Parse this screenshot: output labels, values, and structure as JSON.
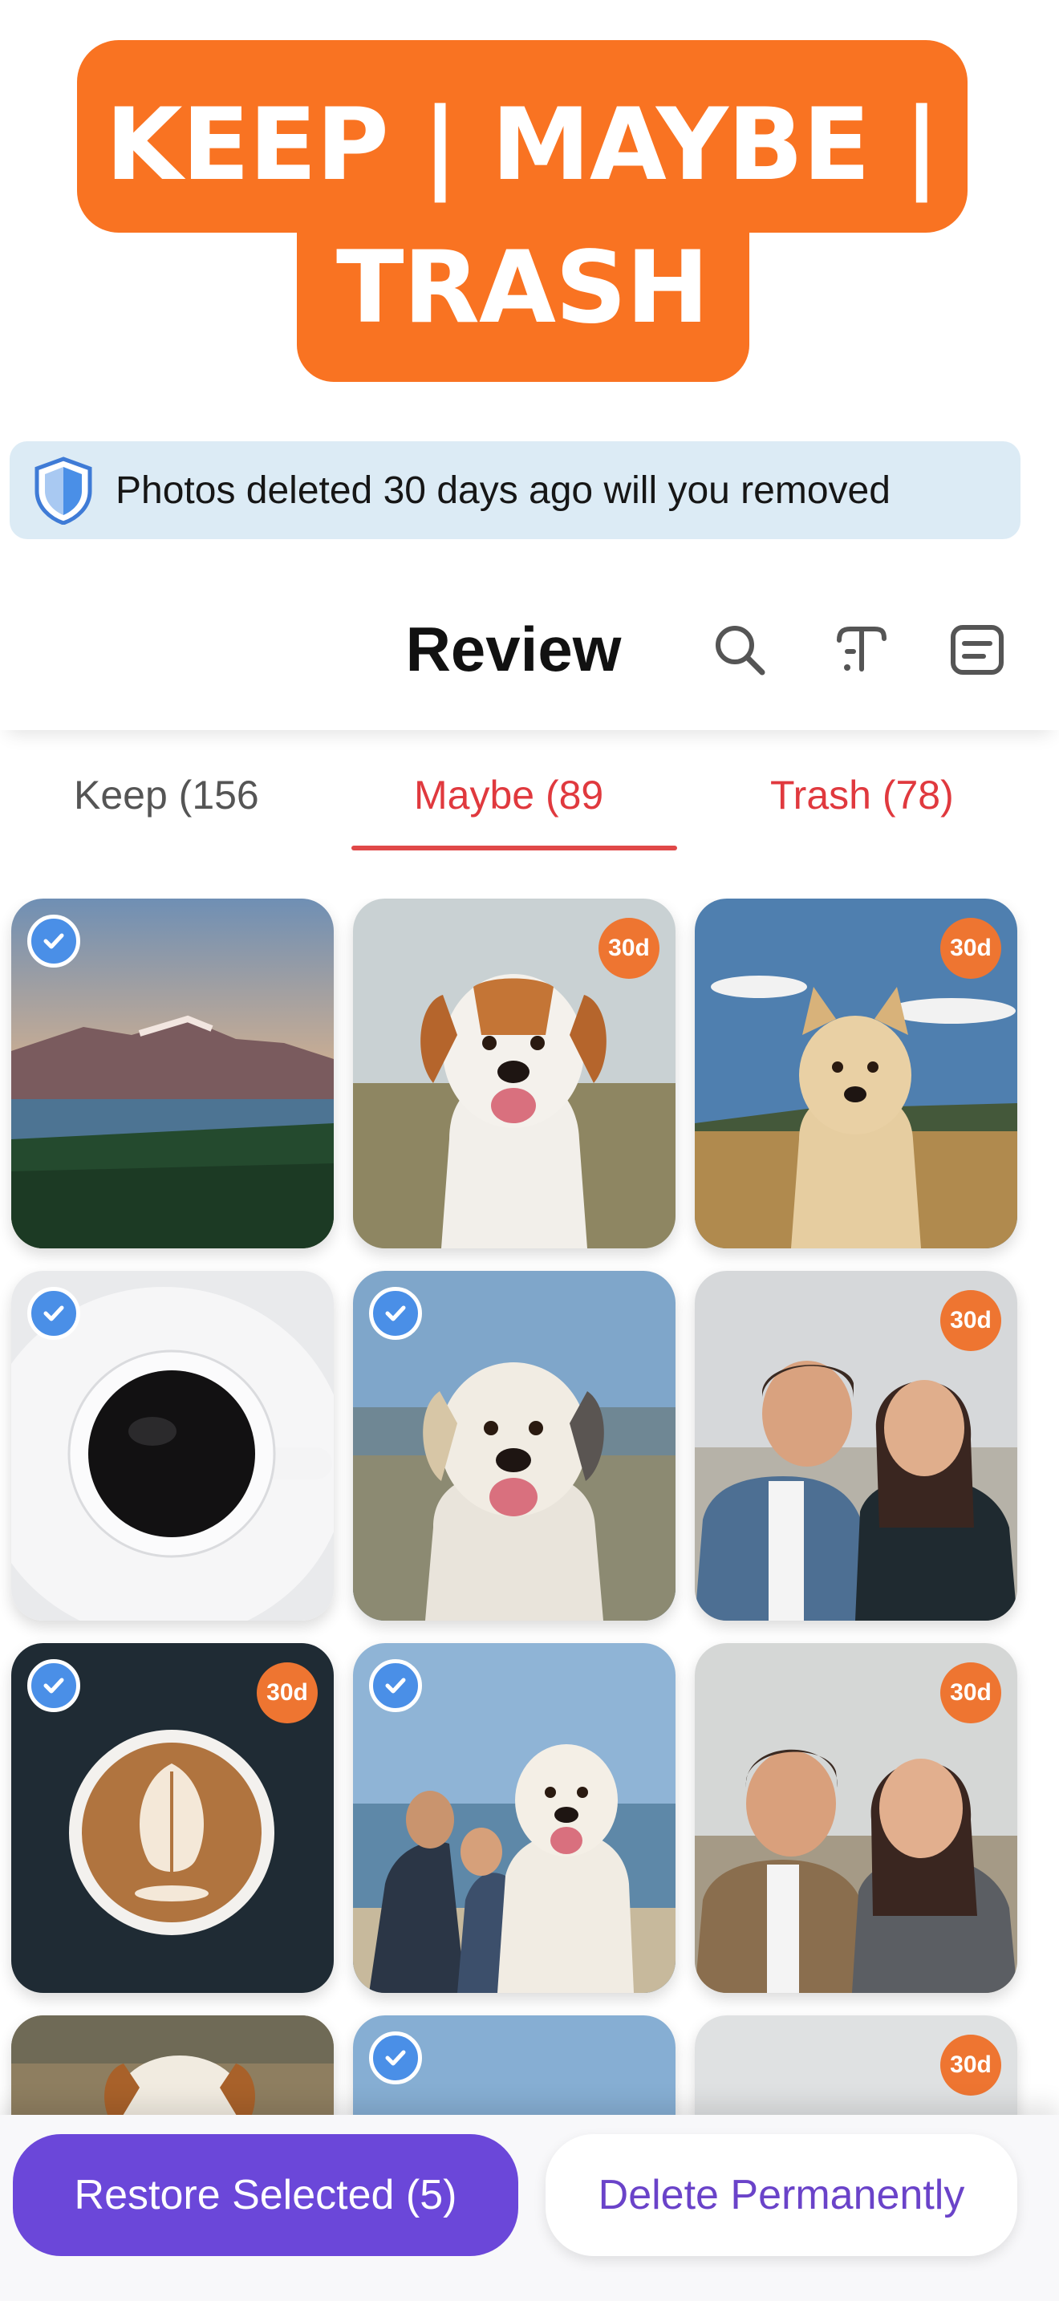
{
  "hero": {
    "line1": "KEEP | MAYBE |",
    "line2": "TRASH",
    "color": "#F97322"
  },
  "notice": {
    "text": "Photos deleted 30 days ago will you removed",
    "icon": "shield-icon",
    "background": "#DCEBF5"
  },
  "header": {
    "title": "Review",
    "icons": [
      "search-icon",
      "text-format-icon",
      "filter-list-icon"
    ]
  },
  "tabs": [
    {
      "label": "Keep (156",
      "active": false
    },
    {
      "label": "Maybe (89",
      "active": true
    },
    {
      "label": "Trash (78)",
      "active": false
    }
  ],
  "photos": [
    {
      "subject": "mountain-lake",
      "selected": true,
      "badge": ""
    },
    {
      "subject": "dog-smiling",
      "selected": false,
      "badge": "30d"
    },
    {
      "subject": "dog-field",
      "selected": false,
      "badge": "30d"
    },
    {
      "subject": "coffee-cup",
      "selected": true,
      "badge": ""
    },
    {
      "subject": "dog-beach",
      "selected": true,
      "badge": ""
    },
    {
      "subject": "couple-beach",
      "selected": false,
      "badge": "30d"
    },
    {
      "subject": "latte-art",
      "selected": true,
      "badge": "30d"
    },
    {
      "subject": "friends-dog-beach",
      "selected": true,
      "badge": ""
    },
    {
      "subject": "couple-smiling",
      "selected": false,
      "badge": "30d"
    },
    {
      "subject": "dog-peeking",
      "selected": false,
      "badge": ""
    },
    {
      "subject": "sky",
      "selected": true,
      "badge": ""
    },
    {
      "subject": "person-partial",
      "selected": false,
      "badge": "30d"
    }
  ],
  "actions": {
    "restore_label": "Restore Selected (5)",
    "delete_label": "Delete Permanently"
  },
  "colors": {
    "accent_purple": "#6B47D9",
    "tab_active": "#E0393E",
    "badge_orange": "#EE7531",
    "check_blue": "#4A8FE7"
  }
}
